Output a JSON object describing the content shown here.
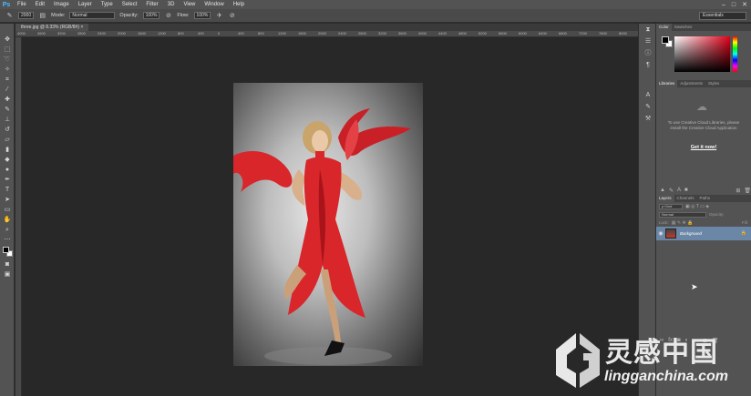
{
  "app": {
    "logo": "Ps"
  },
  "menu": [
    "File",
    "Edit",
    "Image",
    "Layer",
    "Type",
    "Select",
    "Filter",
    "3D",
    "View",
    "Window",
    "Help"
  ],
  "window_controls": [
    "–",
    "□",
    "✕"
  ],
  "options": {
    "brush_size": "2000",
    "mode_label": "Mode:",
    "mode_value": "Normal",
    "opacity_label": "Opacity:",
    "opacity_value": "100%",
    "flow_label": "Flow:",
    "flow_value": "100%",
    "workspace": "Essentials"
  },
  "document": {
    "tab_title": "three.jpg @ 8.33% (RGB/8#)"
  },
  "ruler_ticks": [
    "4000",
    "3600",
    "3200",
    "2800",
    "2400",
    "2000",
    "1600",
    "1200",
    "800",
    "400",
    "0",
    "400",
    "800",
    "1200",
    "1600",
    "2000",
    "2400",
    "2800",
    "3200",
    "3600",
    "4000",
    "4400",
    "4800",
    "5200",
    "5600",
    "6000",
    "6400",
    "6800",
    "7200",
    "7600",
    "8000"
  ],
  "panels": {
    "color_tabs": [
      "Color",
      "Swatches"
    ],
    "library_tabs": [
      "Libraries",
      "Adjustments",
      "Styles"
    ],
    "library_message": "To use Creative Cloud Libraries, please install the Creative Cloud Application",
    "library_link": "Get it now!",
    "layers_tabs": [
      "Layers",
      "Channels",
      "Paths"
    ],
    "kind_label": "ρ Kind",
    "blend_mode": "Normal",
    "opacity_label": "Opacity:",
    "lock_label": "Lock:",
    "fill_label": "Fill:",
    "layer_name": "Background"
  },
  "watermark": {
    "cn": "灵感中国",
    "en": "lingganchina.com"
  },
  "colors": {
    "accent": "#6b87a7",
    "ps_blue": "#4fb7ff",
    "dress_red": "#d8262b"
  }
}
